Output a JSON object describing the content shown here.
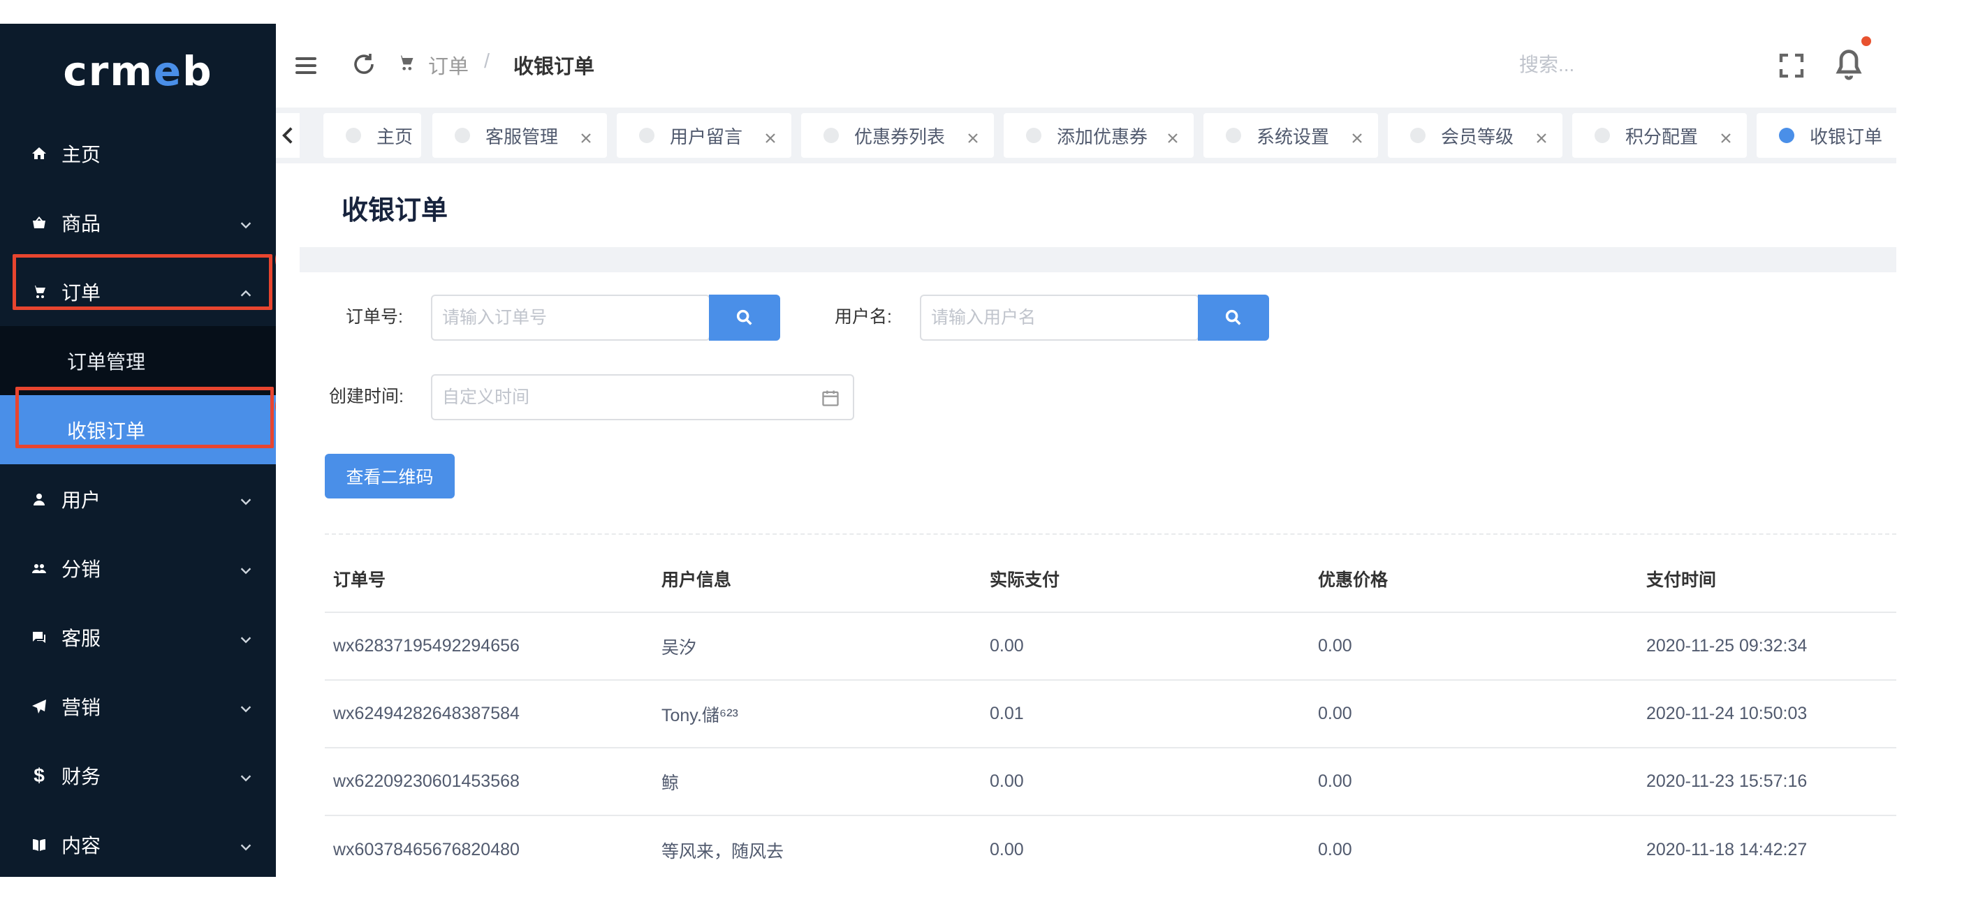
{
  "logo": {
    "text_pre": "crm",
    "text_accent": "e",
    "text_post": "b"
  },
  "sidebar": {
    "items": [
      {
        "label": "主页",
        "icon": "home-icon"
      },
      {
        "label": "商品",
        "icon": "basket-icon"
      },
      {
        "label": "订单",
        "icon": "cart-icon"
      },
      {
        "label": "用户",
        "icon": "user-icon"
      },
      {
        "label": "分销",
        "icon": "group-icon"
      },
      {
        "label": "客服",
        "icon": "chat-icon"
      },
      {
        "label": "营销",
        "icon": "send-icon"
      },
      {
        "label": "财务",
        "icon": "dollar-icon"
      },
      {
        "label": "内容",
        "icon": "book-icon"
      }
    ],
    "order_sub": [
      {
        "label": "订单管理"
      },
      {
        "label": "收银订单"
      }
    ]
  },
  "markers": {
    "m1": "1",
    "m2": "2"
  },
  "header": {
    "breadcrumb_parent": "订单",
    "breadcrumb_sep": "/",
    "breadcrumb_current": "收银订单",
    "search_placeholder": "搜索..."
  },
  "tabs": [
    {
      "label": "主页"
    },
    {
      "label": "客服管理"
    },
    {
      "label": "用户留言"
    },
    {
      "label": "优惠券列表"
    },
    {
      "label": "添加优惠券"
    },
    {
      "label": "系统设置"
    },
    {
      "label": "会员等级"
    },
    {
      "label": "积分配置"
    },
    {
      "label": "收银订单"
    }
  ],
  "page": {
    "title": "收银订单",
    "filters": {
      "order_no_label": "订单号:",
      "order_no_placeholder": "请输入订单号",
      "username_label": "用户名:",
      "username_placeholder": "请输入用户名",
      "created_label": "创建时间:",
      "created_placeholder": "自定义时间"
    },
    "qr_button": "查看二维码"
  },
  "table": {
    "columns": [
      "订单号",
      "用户信息",
      "实际支付",
      "优惠价格",
      "支付时间"
    ],
    "rows": [
      [
        "wx62837195492294656",
        "吴汐",
        "0.00",
        "0.00",
        "2020-11-25 09:32:34"
      ],
      [
        "wx62494282648387584",
        "Tony.儲⁶²³",
        "0.01",
        "0.00",
        "2020-11-24 10:50:03"
      ],
      [
        "wx62209230601453568",
        "鲸",
        "0.00",
        "0.00",
        "2020-11-23 15:57:16"
      ],
      [
        "wx60378465676820480",
        "等风来，随风去",
        "0.00",
        "0.00",
        "2020-11-18 14:42:27"
      ]
    ]
  },
  "colors": {
    "sidebar_bg": "#0c1b2b",
    "accent": "#4a8fe8",
    "highlight": "#e8452f"
  }
}
